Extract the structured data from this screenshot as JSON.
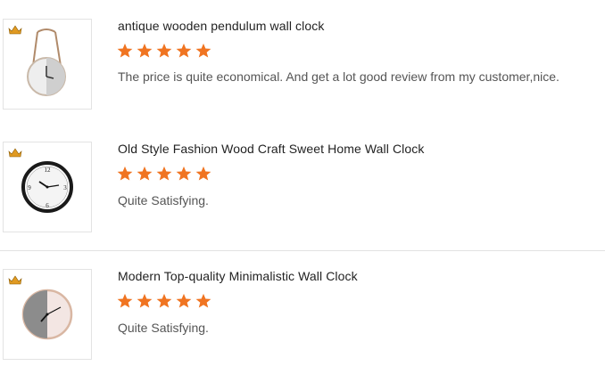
{
  "reviews": [
    {
      "title": "antique wooden pendulum wall clock",
      "rating": 5,
      "text": "The price is quite economical. And get a lot good review from my customer,nice."
    },
    {
      "title": "Old Style Fashion Wood Craft Sweet Home Wall Clock",
      "rating": 5,
      "text": "Quite Satisfying."
    },
    {
      "title": "Modern Top-quality Minimalistic Wall Clock",
      "rating": 5,
      "text": "Quite Satisfying."
    }
  ],
  "colors": {
    "star": "#f07421",
    "badge": "#e09a22",
    "divider": "#e2e2e2"
  },
  "icons": {
    "badge": "crown-badge-icon",
    "star": "star-icon"
  }
}
